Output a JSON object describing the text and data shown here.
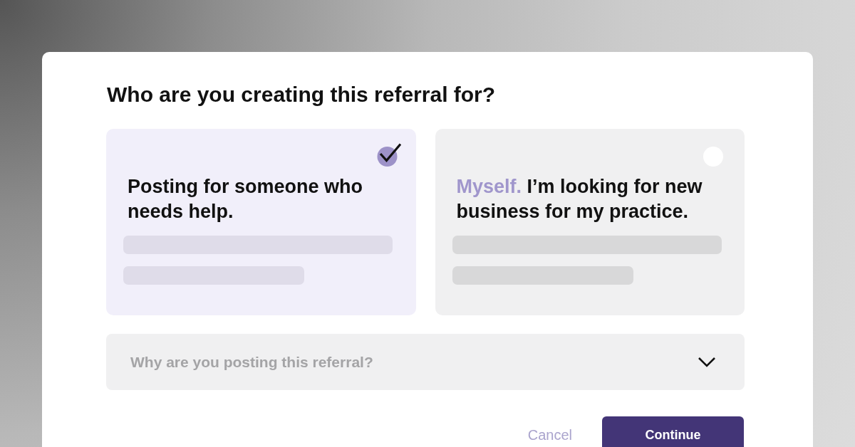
{
  "dialog": {
    "title": "Who are you creating this referral for?",
    "options": [
      {
        "text": "Posting for someone who needs help.",
        "selected": true
      },
      {
        "lead": "Myself.",
        "text": "I’m looking for new business for my practice.",
        "selected": false
      }
    ],
    "reason_select": {
      "placeholder": "Why are you posting this referral?"
    },
    "buttons": [
      {
        "label": "Cancel",
        "kind": "link"
      },
      {
        "label": "Continue",
        "kind": "primary"
      }
    ]
  }
}
